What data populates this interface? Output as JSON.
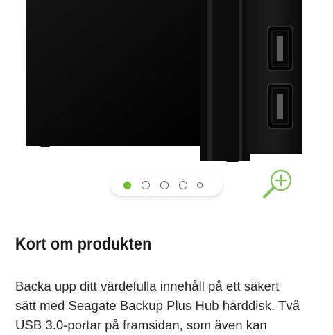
{
  "product": {
    "heading": "Kort om produkten",
    "description_lines": [
      "Backa upp ditt värdefulla innehåll på ett säkert",
      "sätt med Seagate Backup Plus Hub hårddisk. Två",
      "USB 3.0-portar på framsidan, som även kan"
    ]
  },
  "carousel": {
    "total_slides": 5,
    "active_slide": 1
  },
  "colors": {
    "accent": "#6ebe2e",
    "zoom_icon": "#7fc45a",
    "device": "#050505"
  },
  "icons": {
    "zoom": "zoom-in-icon"
  }
}
